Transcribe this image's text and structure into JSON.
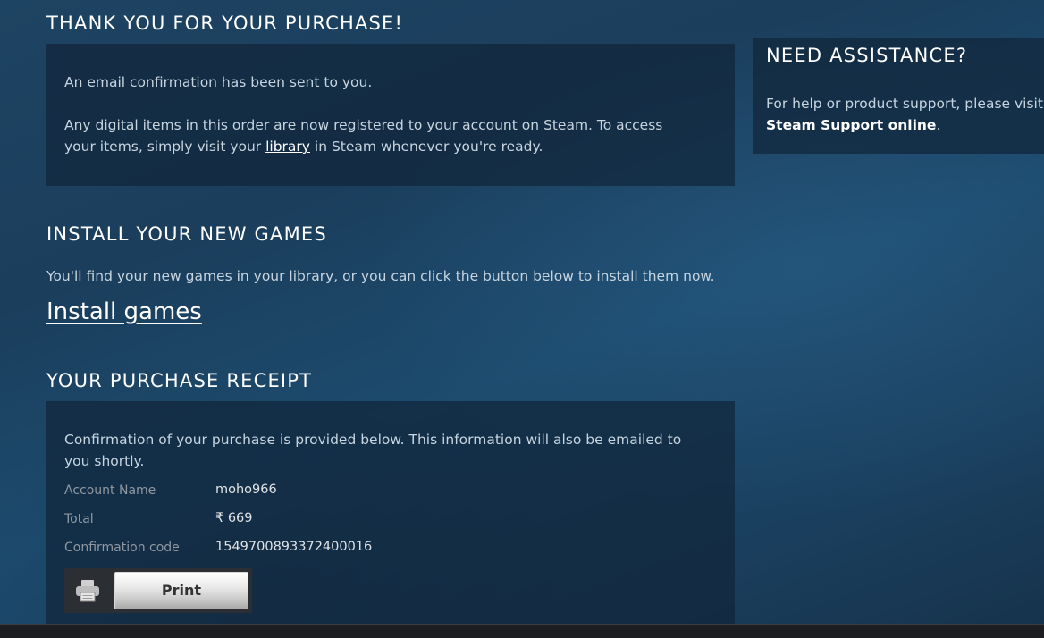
{
  "thanks": {
    "title": "THANK YOU FOR YOUR PURCHASE!",
    "email_notice": "An email confirmation has been sent to you.",
    "digital_items_before": "Any digital items in this order are now registered to your account on Steam. To access your items, simply visit your ",
    "library_link": "library",
    "digital_items_after": " in Steam whenever you're ready."
  },
  "assistance": {
    "title": "NEED ASSISTANCE?",
    "text_before": "For help or product support, please visit ",
    "support_link": "Steam Support online",
    "text_after": "."
  },
  "install": {
    "title": "INSTALL YOUR NEW GAMES",
    "description": "You'll find your new games in your library, or you can click the button below to install them now.",
    "install_link": "Install games"
  },
  "receipt": {
    "title": "YOUR PURCHASE RECEIPT",
    "intro": "Confirmation of your purchase is provided below. This information will also be emailed to you shortly.",
    "rows": [
      {
        "label": "Account Name",
        "value": "moho966"
      },
      {
        "label": "Total",
        "value": "₹ 669"
      },
      {
        "label": "Confirmation code",
        "value": "1549700893372400016"
      }
    ],
    "print_label": "Print",
    "print_icon": "printer-icon"
  },
  "colors": {
    "heading": "#ffffff",
    "body_text": "#c6d4df",
    "label_text": "#8f98a0",
    "panel": "#10263a"
  }
}
